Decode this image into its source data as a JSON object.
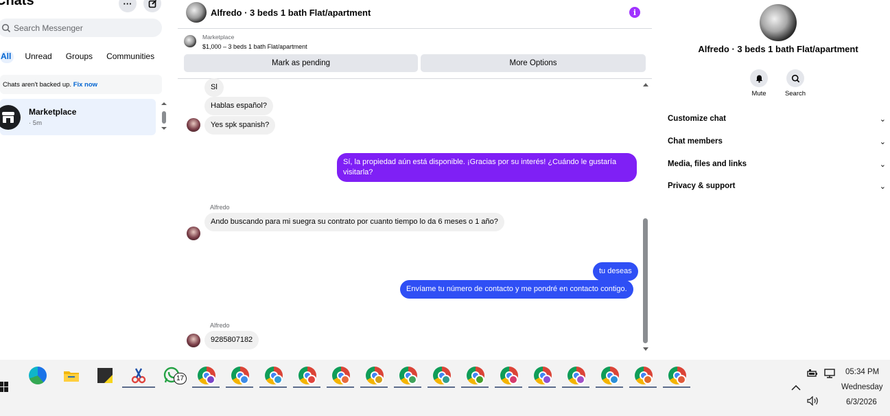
{
  "left": {
    "title": "Chats",
    "search_placeholder": "Search Messenger",
    "filters": [
      "All",
      "Unread",
      "Groups",
      "Communities"
    ],
    "backup_text": "Chats aren't backed up. ",
    "backup_link": "Fix now",
    "chat": {
      "name": "Marketplace",
      "time": "· 5m"
    }
  },
  "header": {
    "title": "Alfredo · 3 beds 1 bath Flat/apartment"
  },
  "marketplace": {
    "label": "Marketplace",
    "price_line": "$1,000 – 3 beds 1 bath Flat/apartment",
    "pending_button": "Mark as pending",
    "options_button": "More Options"
  },
  "messages": {
    "m1": "Sl",
    "m2": "Hablas español?",
    "m3": "Yes spk spanish?",
    "m4": "Sí, la propiedad aún está disponible. ¡Gracias por su interés! ¿Cuándo le gustaría visitarla?",
    "sender1": "Alfredo",
    "m5": "Ando buscando para mi suegra su contrato por cuanto tiempo lo da 6 meses o 1 año?",
    "m6": "tu deseas",
    "m7": "Envíame tu número de contacto y me pondré en contacto contigo.",
    "sender2": "Alfredo",
    "m8": "9285807182"
  },
  "right": {
    "title": "Alfredo · 3 beds 1 bath Flat/apartment",
    "mute_label": "Mute",
    "search_label": "Search",
    "sections": [
      "Customize chat",
      "Chat members",
      "Media, files and links",
      "Privacy & support"
    ]
  },
  "taskbar": {
    "whatsapp_badge": "17",
    "time": "05:34 PM",
    "day": "Wednesday",
    "date": "6/3/2026"
  },
  "colors": {
    "outgoing_purple": "#7f20f5",
    "outgoing_blue": "#2f4ff5",
    "accent_link": "#0064d1"
  }
}
